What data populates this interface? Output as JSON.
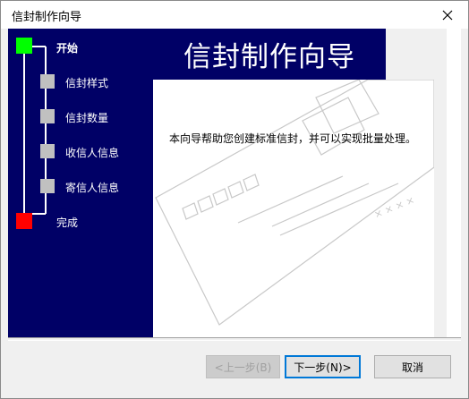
{
  "window": {
    "title": "信封制作向导"
  },
  "header": {
    "title": "信封制作向导"
  },
  "steps": [
    {
      "label": "开始",
      "state": "current",
      "color": "#00ff00"
    },
    {
      "label": "信封样式",
      "state": "pending",
      "color": "#c0c0c0"
    },
    {
      "label": "信封数量",
      "state": "pending",
      "color": "#c0c0c0"
    },
    {
      "label": "收信人信息",
      "state": "pending",
      "color": "#c0c0c0"
    },
    {
      "label": "寄信人信息",
      "state": "pending",
      "color": "#c0c0c0"
    },
    {
      "label": "完成",
      "state": "end",
      "color": "#ff0000"
    }
  ],
  "content": {
    "description": "本向导帮助您创建标准信封，并可以实现批量处理。",
    "envelope_marks": "× × × ×"
  },
  "buttons": {
    "back": "<上一步(B)",
    "next": "下一步(N)>",
    "cancel": "取消"
  },
  "colors": {
    "panel": "#000066",
    "accent": "#0078d7"
  }
}
